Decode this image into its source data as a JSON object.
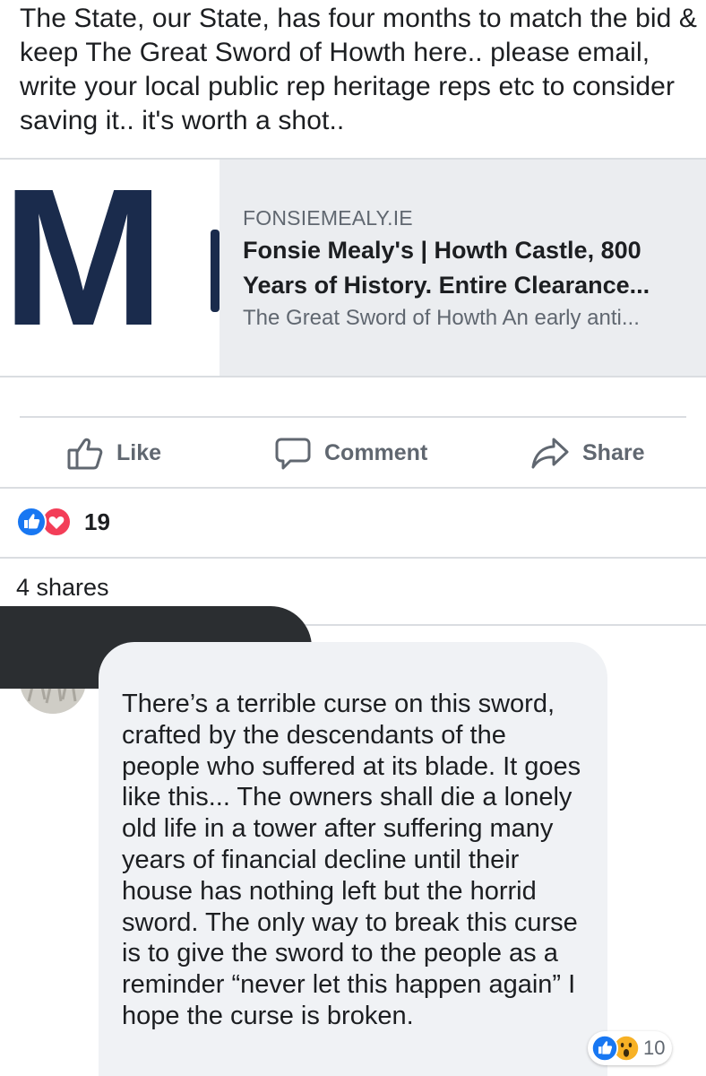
{
  "post": {
    "text": "The State, our State, has four months to match the bid & keep The Great Sword of Howth here.. please email, write your local public rep heritage reps etc to consider saving it.. it's worth a shot.."
  },
  "link_preview": {
    "domain": "FONSIEMEALY.IE",
    "title": "Fonsie Mealy's | Howth Castle, 800 Years of History. Entire Clearance...",
    "description": "The Great Sword of Howth An early anti...",
    "logo_text": "M",
    "logo_color": "#1a2b4c"
  },
  "actions": {
    "like_label": "Like",
    "comment_label": "Comment",
    "share_label": "Share"
  },
  "reactions": {
    "count": "19",
    "types": [
      "like-icon",
      "love-icon"
    ],
    "like_color": "#1877f2",
    "love_color": "#f33e58"
  },
  "shares": {
    "label": "4 shares"
  },
  "comment": {
    "text": "There’s a terrible curse on this sword, crafted by the descendants of the people who suffered at its blade. It goes like this... The owners shall die a lonely old life in a tower after suffering many years of financial decline until their house has nothing left but the horrid sword. The only way to break this curse is to give the sword to the people as a reminder “never let this happen again” I hope the curse is broken.",
    "reaction_count": "10",
    "reaction_types": [
      "like-icon",
      "wow-icon"
    ]
  },
  "colors": {
    "text": "#1c1e21",
    "secondary_text": "#606770",
    "divider": "#dadde1",
    "card_background": "#ebedf0",
    "bubble_background": "#f0f2f5"
  }
}
